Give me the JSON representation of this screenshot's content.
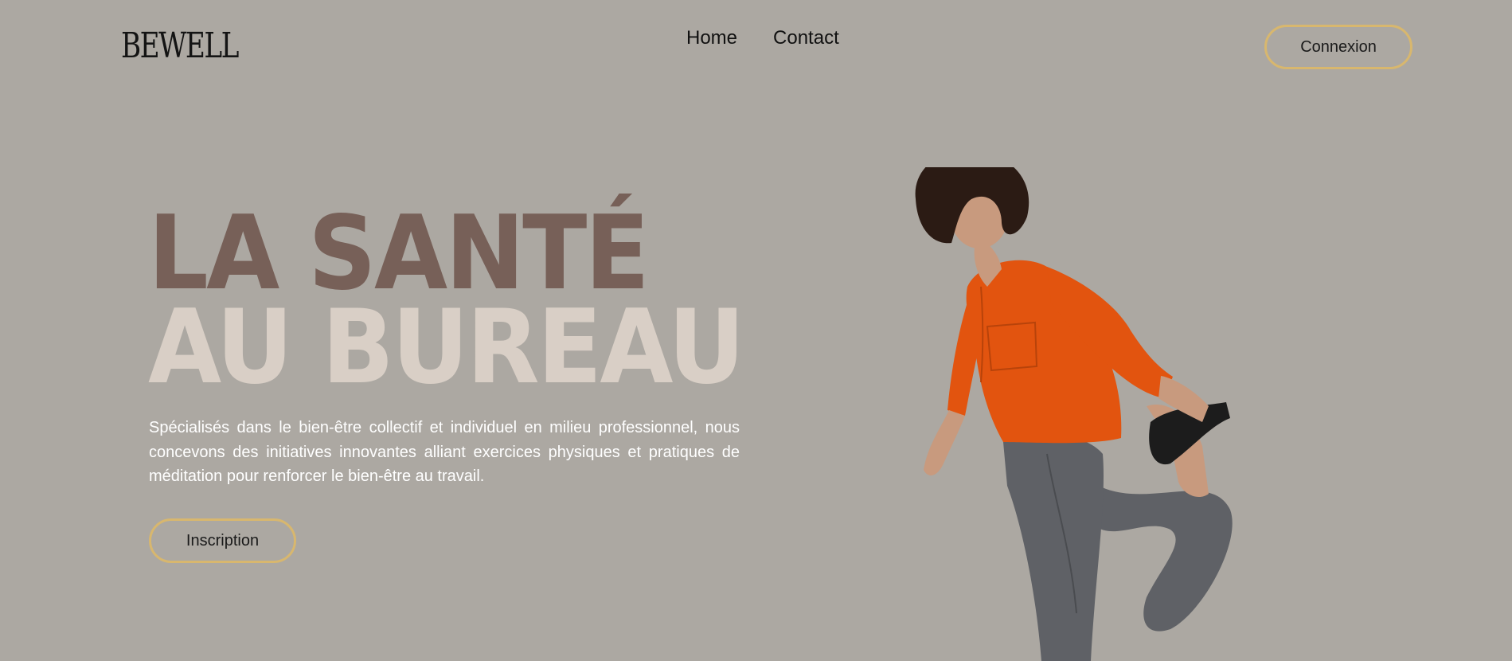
{
  "header": {
    "logo_text": "BEWELL",
    "nav": [
      {
        "label": "Home"
      },
      {
        "label": "Contact"
      }
    ],
    "login_label": "Connexion"
  },
  "hero": {
    "title_line_1": "LA SANTÉ",
    "title_line_2": "AU BUREAU",
    "description": "Spécialisés dans le bien-être collectif et individuel en milieu professionnel, nous concevons des initiatives innovantes alliant exercices physiques et pratiques de méditation pour renforcer le bien-être au travail.",
    "signup_label": "Inscription"
  },
  "colors": {
    "background": "#aca8a2",
    "accent_border": "#d8b76e",
    "title_dark": "#776058",
    "title_light": "#d9cfc6",
    "shirt": "#e2540f",
    "pants": "#5f6166"
  }
}
